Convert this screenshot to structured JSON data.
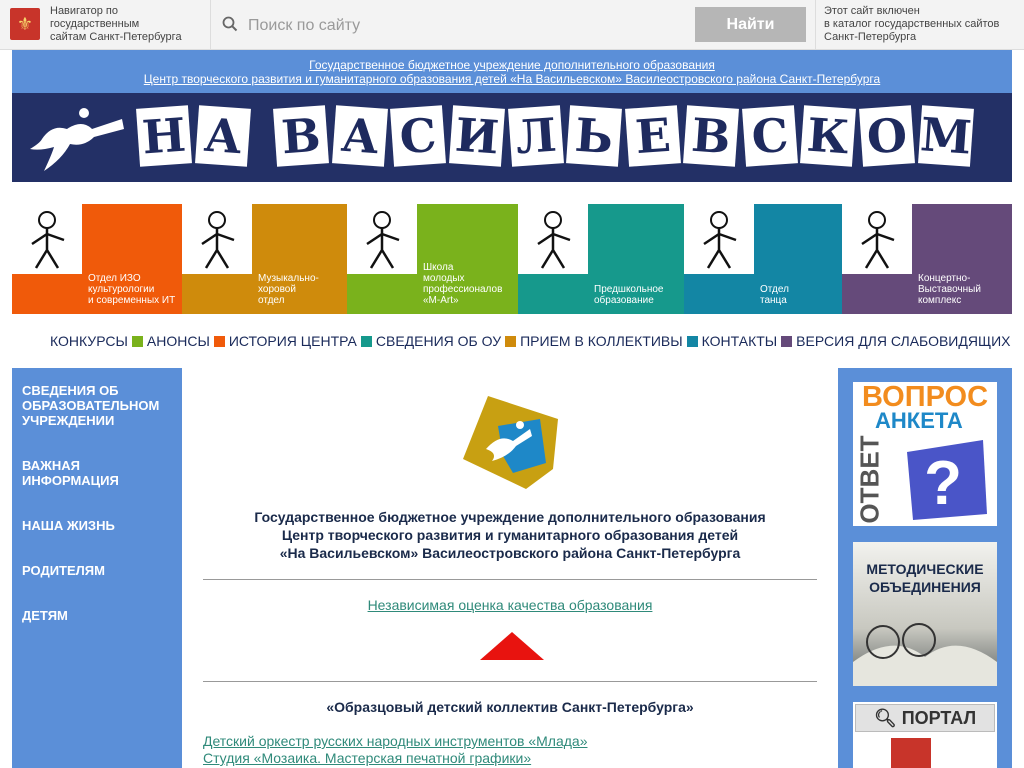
{
  "topbar": {
    "navigator_text": [
      "Навигатор по",
      "государственным",
      "сайтам Санкт-Петербурга"
    ],
    "search_placeholder": "Поиск по сайту",
    "search_button": "Найти",
    "catalog_text": [
      "Этот сайт включен",
      "в каталог государственных сайтов",
      "Санкт-Петербурга"
    ]
  },
  "header": {
    "org_line1": "Государственное бюджетное учреждение дополнительного образования",
    "org_line2": "Центр творческого развития и гуманитарного образования детей «На Васильевском» Василеостровского района Санкт-Петербурга",
    "banner_letters": [
      "Н",
      "А",
      "В",
      "А",
      "С",
      "И",
      "Л",
      "Ь",
      "Е",
      "В",
      "С",
      "К",
      "О",
      "М"
    ]
  },
  "departments": [
    {
      "lines": [
        "Отдел ИЗО",
        "культурологии",
        "и современных ИТ"
      ],
      "color": "#f05a0a"
    },
    {
      "lines": [
        "Музыкально-",
        "хоровой",
        "отдел"
      ],
      "color": "#cf8b0c"
    },
    {
      "lines": [
        "Школа",
        "молодых",
        "профессионалов",
        "«M-Art»"
      ],
      "color": "#7ab21c"
    },
    {
      "lines": [
        "Предшкольное",
        "образование"
      ],
      "color": "#16998c"
    },
    {
      "lines": [
        "Отдел",
        "танца"
      ],
      "color": "#1386a4"
    },
    {
      "lines": [
        "Концертно-",
        "Выставочный",
        "комплекс"
      ],
      "color": "#654a7a"
    }
  ],
  "menu": [
    {
      "label": "КОНКУРСЫ",
      "sq": "#7ab21c"
    },
    {
      "label": "АНОНСЫ",
      "sq": "#f05a0a"
    },
    {
      "label": "ИСТОРИЯ ЦЕНТРА",
      "sq": "#16998c"
    },
    {
      "label": "СВЕДЕНИЯ ОБ ОУ",
      "sq": "#cf8b0c"
    },
    {
      "label": "ПРИЕМ В КОЛЛЕКТИВЫ",
      "sq": "#1386a4"
    },
    {
      "label": "КОНТАКТЫ",
      "sq": "#654a7a"
    },
    {
      "label": "ВЕРСИЯ ДЛЯ СЛАБОВИДЯЩИХ",
      "sq": ""
    }
  ],
  "sidebar": {
    "items": [
      {
        "lines": [
          "СВЕДЕНИЯ ОБ",
          "ОБРАЗОВАТЕЛЬНОМ",
          "УЧРЕЖДЕНИИ"
        ]
      },
      {
        "lines": [
          "ВАЖНАЯ",
          "ИНФОРМАЦИЯ"
        ]
      },
      {
        "lines": [
          "НАША ЖИЗНЬ"
        ]
      },
      {
        "lines": [
          "РОДИТЕЛЯМ"
        ]
      },
      {
        "lines": [
          "ДЕТЯМ"
        ]
      }
    ]
  },
  "content": {
    "title": [
      "Государственное бюджетное учреждение дополнительного образования",
      "Центр творческого развития и гуманитарного образования детей",
      "«На Васильевском» Василеостровского района Санкт-Петербурга"
    ],
    "quality_link": "Независимая оценка качества образования",
    "section_title": "«Образцовый детский коллектив Санкт-Петербурга»",
    "links": [
      "Детский оркестр русских народных инструментов «Млада»",
      "Студия «Мозаика. Мастерская печатной графики»"
    ]
  },
  "rightbar": {
    "vopros": "ВОПРОС",
    "otvet": "ОТВЕТ",
    "anketa": "АНКЕТА",
    "metod": [
      "МЕТОДИЧЕСКИЕ",
      "ОБЪЕДИНЕНИЯ"
    ],
    "portal": "ПОРТАЛ"
  },
  "colors": {
    "blue": "#5b8fd8",
    "navy": "#233066",
    "link": "#2f8a7a"
  }
}
